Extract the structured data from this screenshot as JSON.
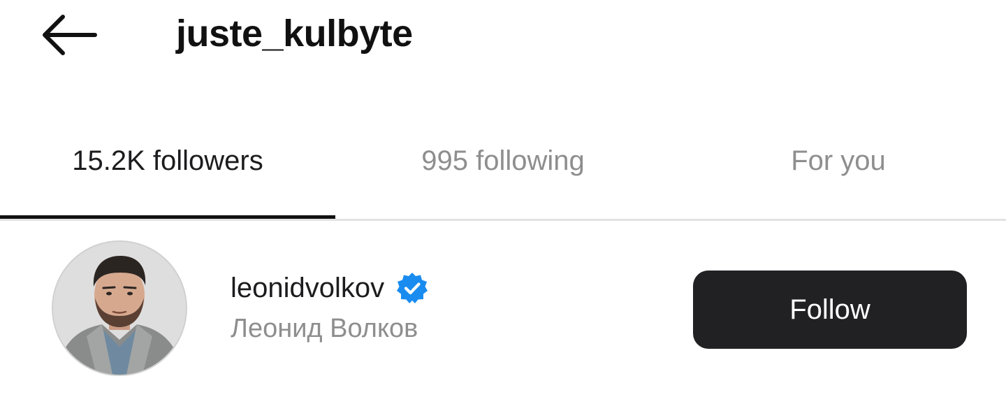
{
  "header": {
    "back_icon": "arrow-left-icon",
    "title": "juste_kulbyte"
  },
  "tabs": [
    {
      "label": "15.2K followers",
      "active": true
    },
    {
      "label": "995 following",
      "active": false
    },
    {
      "label": "For you",
      "active": false
    }
  ],
  "list": {
    "items": [
      {
        "handle": "leonidvolkov",
        "verified": true,
        "verified_icon": "verified-badge-icon",
        "full_name": "Леонид Волков",
        "avatar_icon": "profile-photo",
        "action_label": "Follow"
      }
    ]
  },
  "colors": {
    "verified_blue": "#1a8cf0",
    "follow_button_bg": "#212124",
    "muted_text": "#8e8e8e"
  }
}
